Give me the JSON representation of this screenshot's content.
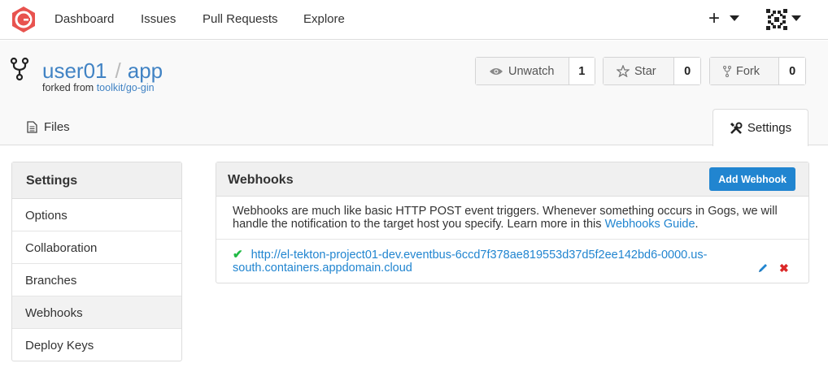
{
  "nav": {
    "items": [
      "Dashboard",
      "Issues",
      "Pull Requests",
      "Explore"
    ],
    "plus_label": "+"
  },
  "repo": {
    "owner": "user01",
    "separator": "/",
    "name": "app",
    "forked_prefix": "forked from",
    "forked_from": "toolkit/go-gin"
  },
  "actions": {
    "watch": {
      "label": "Unwatch",
      "count": "1"
    },
    "star": {
      "label": "Star",
      "count": "0"
    },
    "fork": {
      "label": "Fork",
      "count": "0"
    }
  },
  "tabs": {
    "files": "Files",
    "settings": "Settings"
  },
  "sidebar": {
    "title": "Settings",
    "items": [
      "Options",
      "Collaboration",
      "Branches",
      "Webhooks",
      "Deploy Keys"
    ],
    "active": "Webhooks"
  },
  "webhooks": {
    "title": "Webhooks",
    "add_button": "Add Webhook",
    "description": "Webhooks are much like basic HTTP POST event triggers. Whenever something occurs in Gogs, we will handle the notification to the target host you specify. Learn more in this",
    "guide_link": "Webhooks Guide",
    "period": ".",
    "hooks": [
      {
        "url": "http://el-tekton-project01-dev.eventbus-6ccd7f378ae819553d37d5f2ee142bd6-0000.us-south.containers.appdomain.cloud",
        "status": "ok"
      }
    ]
  },
  "colors": {
    "accent": "#2185d0",
    "link": "#4183c4",
    "success": "#21ba45",
    "danger": "#db2828",
    "logo": "#e8534f"
  }
}
